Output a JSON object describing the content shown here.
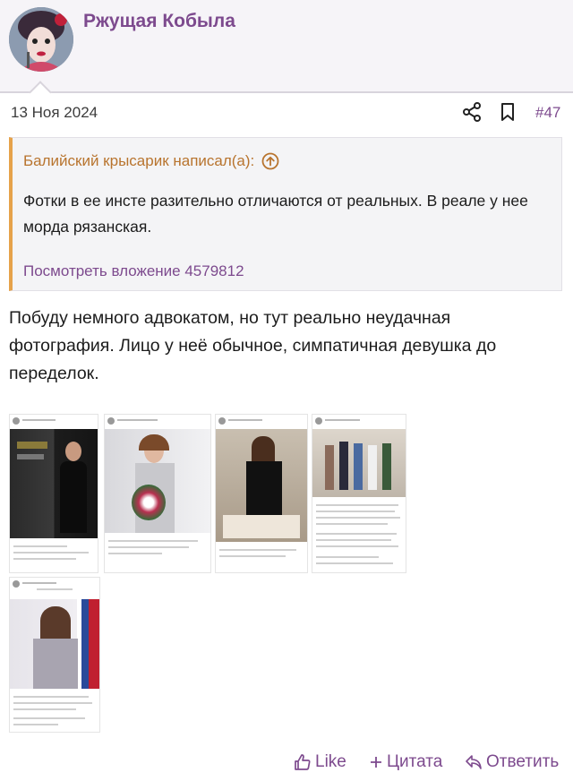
{
  "user": {
    "name": "Ржущая Кобыла"
  },
  "post": {
    "date": "13 Ноя 2024",
    "number": "#47"
  },
  "quote": {
    "author_line": "Балийский крысарик написал(а):",
    "text": "Фотки в ее инсте разительно отличаются от реальных. В реале у нее морда рязанская.",
    "attachment_link": "Посмотреть вложение 4579812"
  },
  "body": {
    "text": "Побуду немного адвокатом, но тут реально неудачная фотография. Лицо у неё обычное, симпатичная девушка до переделок."
  },
  "actions": {
    "like": "Like",
    "quote": "Цитата",
    "reply": "Ответить"
  },
  "colors": {
    "accent": "#7d4a8e",
    "quote_border": "#e6a24a",
    "quote_head": "#b8742e"
  },
  "icons": [
    "share-icon",
    "bookmark-icon",
    "arrow-up-circle-icon",
    "thumbs-up-icon",
    "plus-icon",
    "reply-icon"
  ]
}
